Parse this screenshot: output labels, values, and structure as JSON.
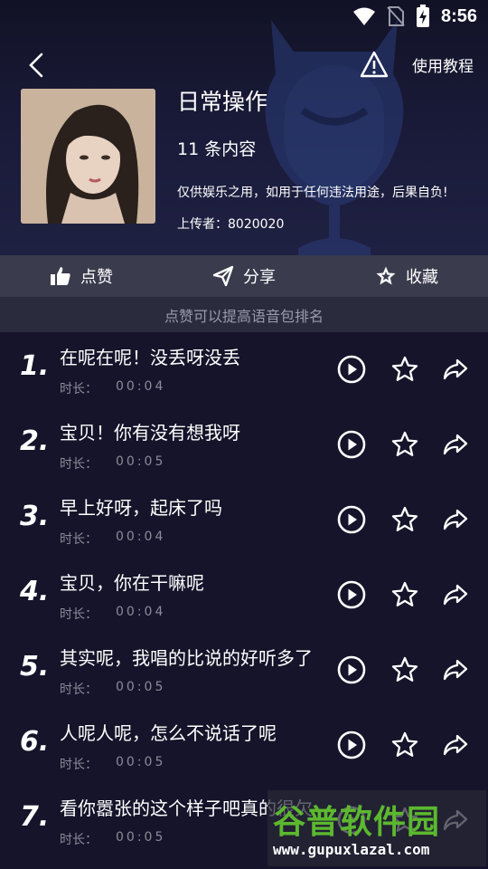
{
  "status_bar": {
    "time": "8:56"
  },
  "header": {
    "tutorial_label": "使用教程",
    "title": "日常操作",
    "count": "11 条内容",
    "disclaimer": "仅供娱乐之用，如用于任何违法用途，后果自负!",
    "uploader": "上传者：8020020"
  },
  "actions": {
    "like_label": "点赞",
    "share_label": "分享",
    "favorite_label": "收藏"
  },
  "hint": "点赞可以提高语音包排名",
  "duration_label": "时长：",
  "items": [
    {
      "num": "1.",
      "title": "在呢在呢！没丢呀没丢",
      "duration": "00:04"
    },
    {
      "num": "2.",
      "title": "宝贝！你有没有想我呀",
      "duration": "00:05"
    },
    {
      "num": "3.",
      "title": "早上好呀，起床了吗",
      "duration": "00:04"
    },
    {
      "num": "4.",
      "title": "宝贝，你在干嘛呢",
      "duration": "00:04"
    },
    {
      "num": "5.",
      "title": "其实呢，我唱的比说的好听多了",
      "duration": "00:05"
    },
    {
      "num": "6.",
      "title": "人呢人呢，怎么不说话了呢",
      "duration": "00:05"
    },
    {
      "num": "7.",
      "title": "看你嚣张的这个样子吧真的很欠",
      "duration": "00:05"
    }
  ],
  "watermark": {
    "name": "谷普软件园",
    "url": "www.gupuxlazal.com"
  },
  "colors": {
    "background": "#15142a",
    "action_bar": "#3a3b4d",
    "hint_bar": "#2a2b3d",
    "watermark_green": "#5cb82e"
  }
}
